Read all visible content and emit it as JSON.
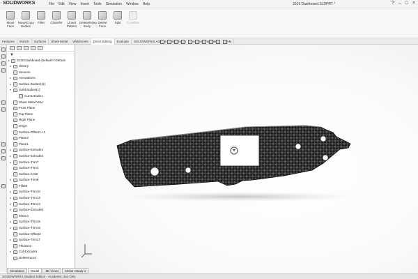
{
  "app": {
    "logo": "SOLIDWORKS",
    "doc_title": "2019 Dashboard.SLDPRT *",
    "window_controls": [
      "?",
      "–",
      "□",
      "×"
    ]
  },
  "menu": [
    "File",
    "Edit",
    "View",
    "Insert",
    "Tools",
    "Simulation",
    "Window",
    "Help"
  ],
  "ribbon": [
    {
      "label": "Move\nFace",
      "icon": "move-face-icon",
      "enabled": true
    },
    {
      "label": "Move/Copy\nBodies",
      "icon": "move-copy-bodies-icon",
      "enabled": true
    },
    {
      "label": "Fillet",
      "icon": "fillet-icon",
      "enabled": true
    },
    {
      "label": "Chamfer",
      "icon": "chamfer-icon",
      "enabled": true
    },
    {
      "label": "Linear\nPattern",
      "icon": "linear-pattern-icon",
      "enabled": true
    },
    {
      "label": "Delete/Keep\nBody",
      "icon": "delete-keep-body-icon",
      "enabled": true
    },
    {
      "label": "Delete\nFace",
      "icon": "delete-face-icon",
      "enabled": true
    },
    {
      "label": "Split",
      "icon": "split-icon",
      "enabled": true
    },
    {
      "label": "Combine",
      "icon": "combine-icon",
      "enabled": false
    }
  ],
  "tabs": [
    {
      "label": "Features",
      "active": false
    },
    {
      "label": "Sketch",
      "active": false
    },
    {
      "label": "Surfaces",
      "active": false
    },
    {
      "label": "Sheet Metal",
      "active": false
    },
    {
      "label": "Weldments",
      "active": false
    },
    {
      "label": "Direct Editing",
      "active": true
    },
    {
      "label": "Evaluate",
      "active": false
    },
    {
      "label": "SOLIDWORKS Add-Ins",
      "active": false
    },
    {
      "label": "Simulation",
      "active": false
    },
    {
      "label": "Analysis Preparation",
      "active": false
    },
    {
      "label": "CAM",
      "active": false
    }
  ],
  "tree": {
    "root": "2019 Dashboard  (Default<<Default",
    "items": [
      {
        "label": "History",
        "indent": 1,
        "expander": "▸"
      },
      {
        "label": "Sensors",
        "indent": 1,
        "expander": ""
      },
      {
        "label": "Annotations",
        "indent": 1,
        "expander": "▸"
      },
      {
        "label": "Surface Bodies(11)",
        "indent": 1,
        "expander": "▸"
      },
      {
        "label": "Solid Bodies(1)",
        "indent": 1,
        "expander": "▾"
      },
      {
        "label": "Cut-Extrude1",
        "indent": 2,
        "expander": ""
      },
      {
        "label": "Sheet Metal VMA",
        "indent": 1,
        "expander": ""
      },
      {
        "label": "Front Plane",
        "indent": 1,
        "expander": ""
      },
      {
        "label": "Top Plane",
        "indent": 1,
        "expander": ""
      },
      {
        "label": "Right Plane",
        "indent": 1,
        "expander": ""
      },
      {
        "label": "Origin",
        "indent": 1,
        "expander": ""
      },
      {
        "label": "Surface-Offset1->1",
        "indent": 1,
        "expander": ""
      },
      {
        "label": "Plane2",
        "indent": 1,
        "expander": ""
      },
      {
        "label": "Plane1",
        "indent": 1,
        "expander": ""
      },
      {
        "label": "Surface-Extrude1",
        "indent": 1,
        "expander": "▸"
      },
      {
        "label": "Surface-Extrude3",
        "indent": 1,
        "expander": "▸"
      },
      {
        "label": "Surface-Trim7",
        "indent": 1,
        "expander": "▸"
      },
      {
        "label": "Surface-Trim2",
        "indent": 1,
        "expander": ""
      },
      {
        "label": "Surface-Knit2",
        "indent": 1,
        "expander": ""
      },
      {
        "label": "Surface-Trim9",
        "indent": 1,
        "expander": "▸"
      },
      {
        "label": "Fillet8",
        "indent": 1,
        "expander": ""
      },
      {
        "label": "Surface-Trim10",
        "indent": 1,
        "expander": "▸"
      },
      {
        "label": "Surface-Trim12",
        "indent": 1,
        "expander": "▸"
      },
      {
        "label": "Surface-Trim13",
        "indent": 1,
        "expander": "▸"
      },
      {
        "label": "Surface-Extrude6",
        "indent": 1,
        "expander": "▸"
      },
      {
        "label": "Mirror1",
        "indent": 1,
        "expander": ""
      },
      {
        "label": "Surface-Trim15",
        "indent": 1,
        "expander": "▸"
      },
      {
        "label": "Surface-Trim16",
        "indent": 1,
        "expander": "▸"
      },
      {
        "label": "Surface-Offset3",
        "indent": 1,
        "expander": ""
      },
      {
        "label": "Surface-Trim17",
        "indent": 1,
        "expander": "▸"
      },
      {
        "label": "Thicken1",
        "indent": 1,
        "expander": ""
      },
      {
        "label": "Cut-Extrude1",
        "indent": 1,
        "expander": "▸"
      },
      {
        "label": "DeleteFace1",
        "indent": 1,
        "expander": ""
      }
    ]
  },
  "bottom_tabs": [
    {
      "label": "Simulation",
      "active": false
    },
    {
      "label": "Model",
      "active": true
    },
    {
      "label": "3D Views",
      "active": false
    },
    {
      "label": "Motion Study 1",
      "active": false
    }
  ],
  "status": "SOLIDWORKS Student Edition - Academic Use Only",
  "colors": {
    "accent": "#333333",
    "carbon_light": "#5a5a5a",
    "carbon_dark": "#1c1c1c"
  }
}
